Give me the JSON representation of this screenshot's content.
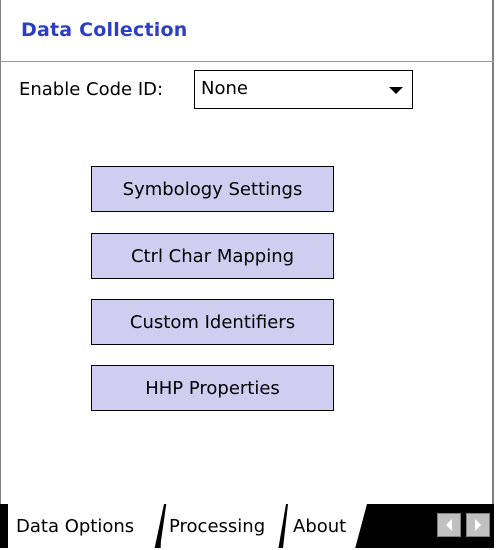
{
  "header": {
    "title": "Data Collection"
  },
  "code_id": {
    "label": "Enable Code ID:",
    "selected": "None"
  },
  "buttons": [
    {
      "label": "Symbology Settings"
    },
    {
      "label": "Ctrl Char Mapping"
    },
    {
      "label": "Custom Identifiers"
    },
    {
      "label": "HHP Properties"
    }
  ],
  "tabs": [
    {
      "label": "Data Options",
      "active": true
    },
    {
      "label": "Processing",
      "active": false
    },
    {
      "label": "About",
      "active": false
    }
  ],
  "colors": {
    "title": "#2c3ec4",
    "button_bg": "#cfcdf0",
    "tabbar_bg": "#000000",
    "scroll_btn_bg": "#c0c0c0"
  },
  "icons": {
    "dropdown": "chevron-down-icon",
    "scroll_left": "arrow-left-icon",
    "scroll_right": "arrow-right-icon"
  }
}
